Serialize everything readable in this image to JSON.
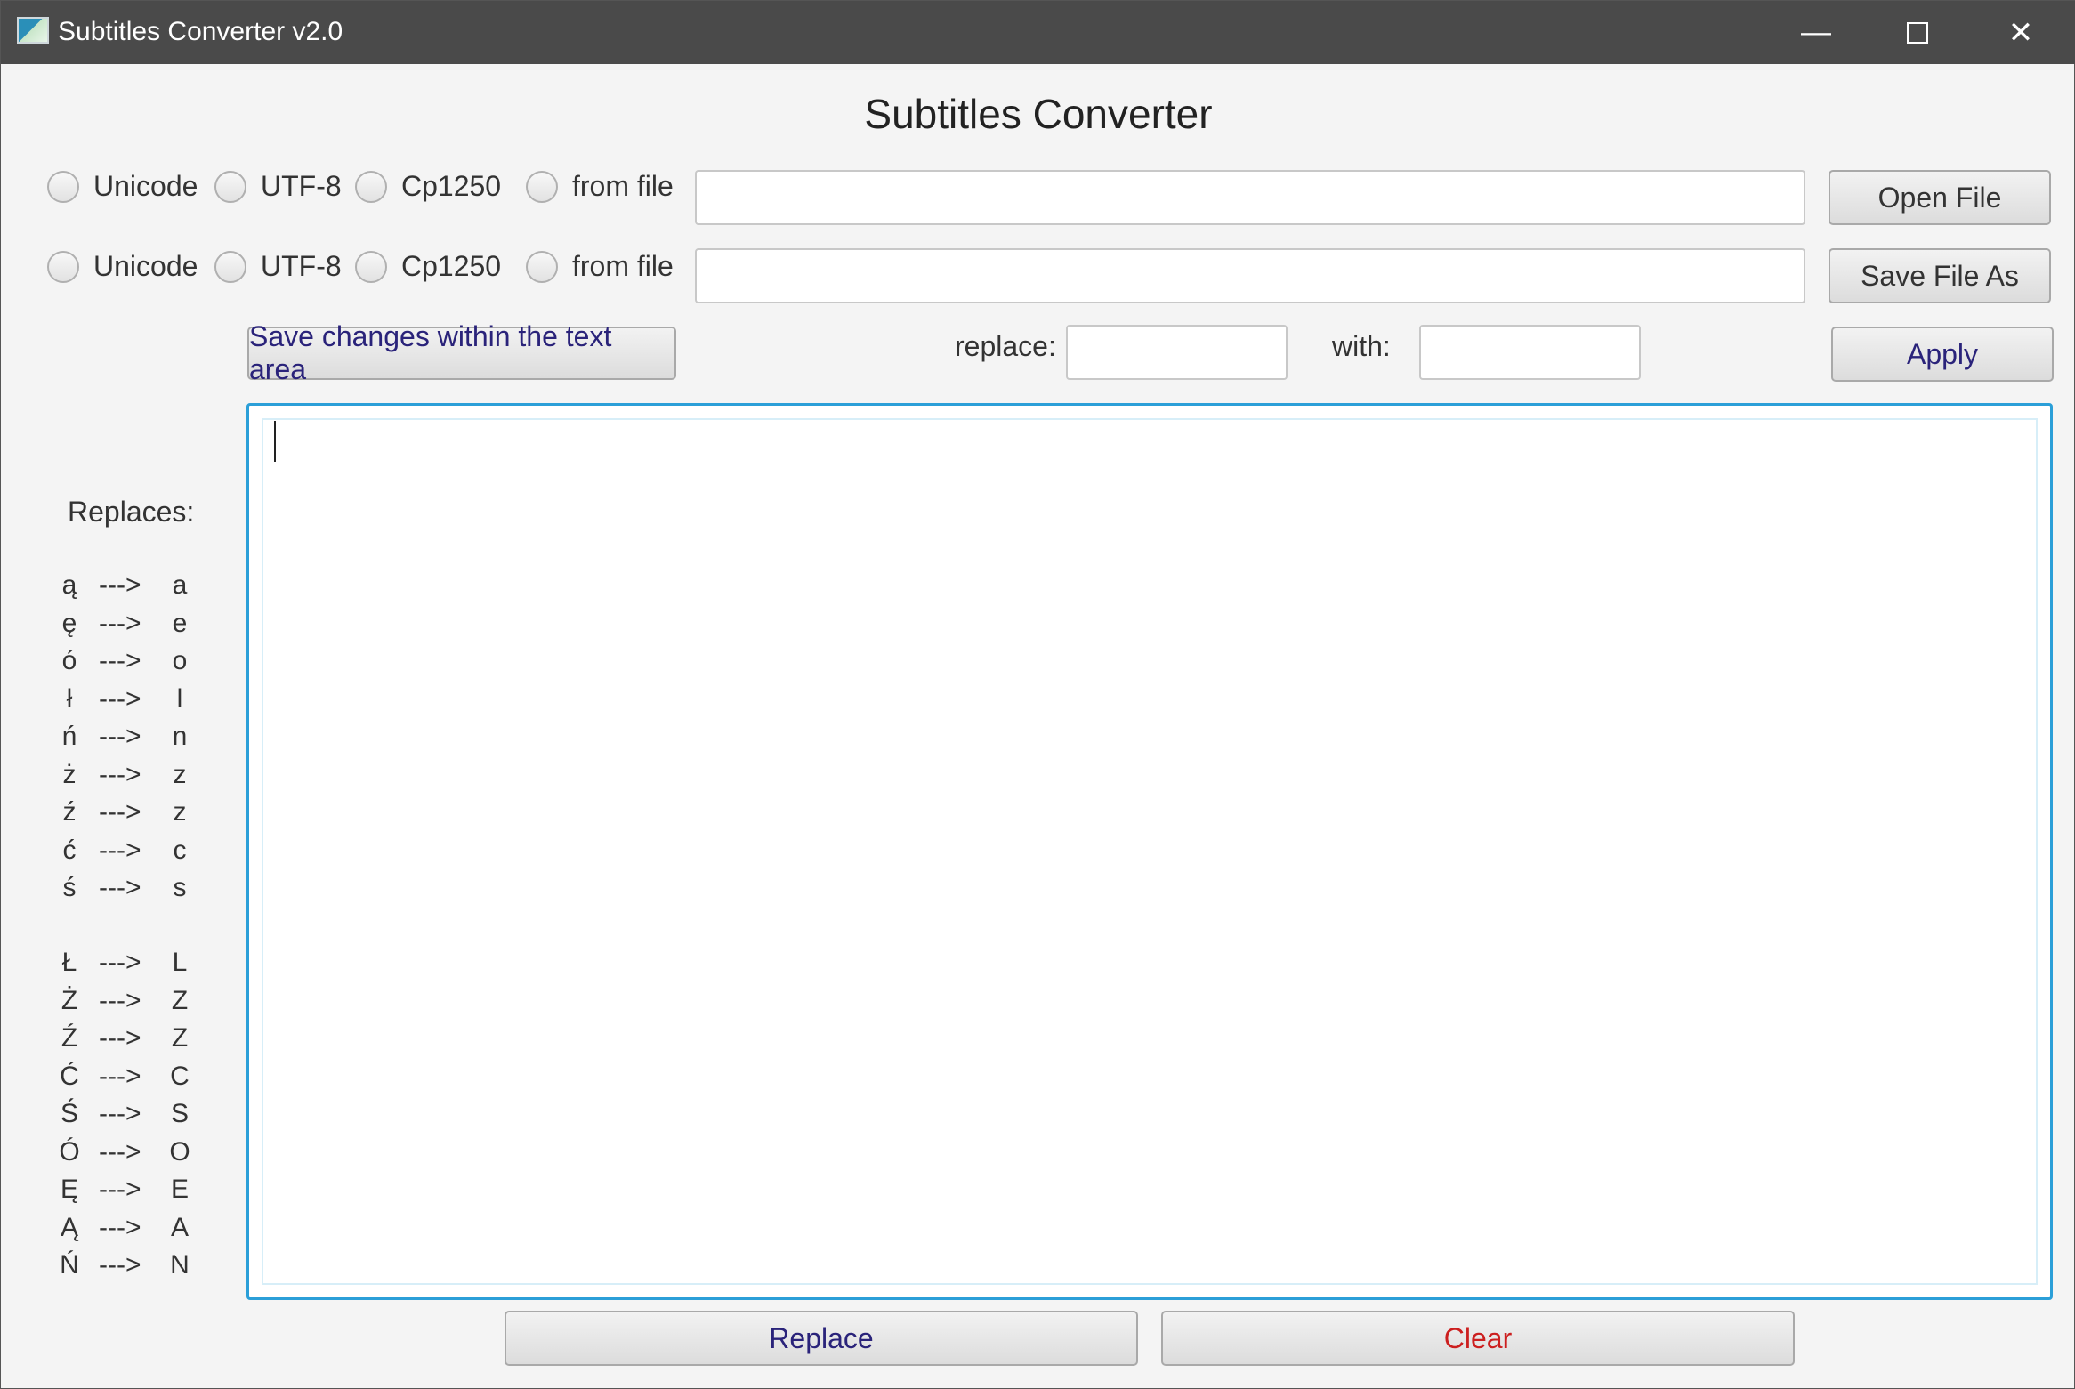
{
  "window": {
    "title": "Subtitles Converter v2.0",
    "min": "—",
    "close": "✕"
  },
  "heading": "Subtitles Converter",
  "row1": {
    "options": [
      "Unicode",
      "UTF-8",
      "Cp1250",
      "from file"
    ],
    "path": "",
    "button": "Open File"
  },
  "row2": {
    "options": [
      "Unicode",
      "UTF-8",
      "Cp1250",
      "from file"
    ],
    "path": "",
    "button": "Save File As"
  },
  "toolbar": {
    "save_changes": "Save changes within the text area",
    "replace_label": "replace:",
    "replace_value": "",
    "with_label": "with:",
    "with_value": "",
    "apply": "Apply"
  },
  "sidebar": {
    "title": "Replaces:",
    "arrow": "--->",
    "lower": [
      [
        "ą",
        "a"
      ],
      [
        "ę",
        "e"
      ],
      [
        "ó",
        "o"
      ],
      [
        "ł",
        "l"
      ],
      [
        "ń",
        "n"
      ],
      [
        "ż",
        "z"
      ],
      [
        "ź",
        "z"
      ],
      [
        "ć",
        "c"
      ],
      [
        "ś",
        "s"
      ]
    ],
    "upper": [
      [
        "Ł",
        "L"
      ],
      [
        "Ż",
        "Z"
      ],
      [
        "Ź",
        "Z"
      ],
      [
        "Ć",
        "C"
      ],
      [
        "Ś",
        "S"
      ],
      [
        "Ó",
        "O"
      ],
      [
        "Ę",
        "E"
      ],
      [
        "Ą",
        "A"
      ],
      [
        "Ń",
        "N"
      ]
    ]
  },
  "editor": {
    "text": ""
  },
  "footer": {
    "replace": "Replace",
    "clear": "Clear"
  }
}
